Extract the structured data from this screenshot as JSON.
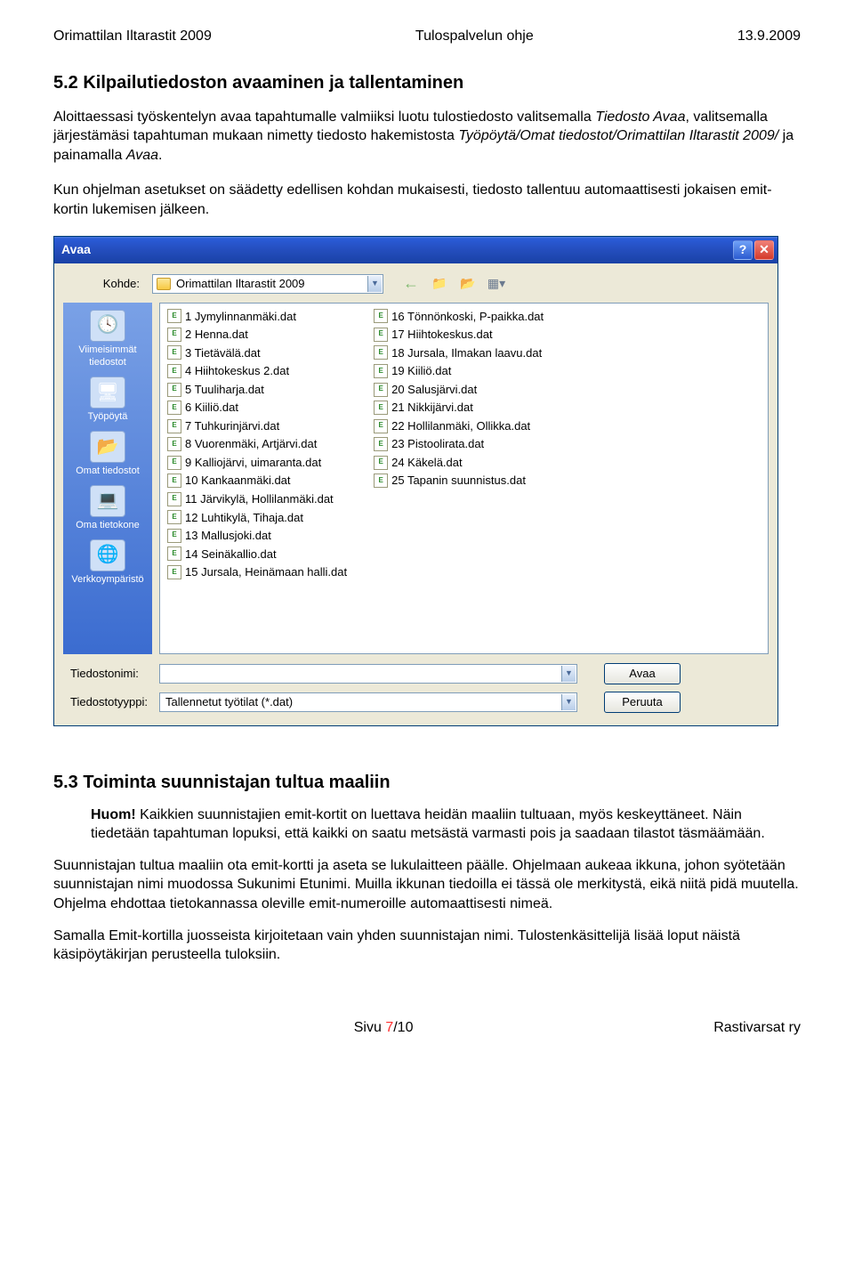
{
  "header": {
    "left": "Orimattilan Iltarastit 2009",
    "center": "Tulospalvelun ohje",
    "right": "13.9.2009"
  },
  "section52": {
    "title": "5.2 Kilpailutiedoston avaaminen ja tallentaminen",
    "p1a": "Aloittaessasi työskentelyn avaa tapahtumalle valmiiksi luotu tulostiedosto valitsemalla ",
    "p1b": "Tiedosto Avaa",
    "p1c": ", valitsemalla järjestämäsi tapahtuman mukaan nimetty tiedosto hakemistosta ",
    "p1d": "Työpöytä/Omat tiedostot/Orimattilan Iltarastit 2009/",
    "p1e": " ja painamalla ",
    "p1f": "Avaa",
    "p1g": ".",
    "p2": "Kun ohjelman asetukset on säädetty edellisen kohdan mukaisesti, tiedosto tallentuu automaattisesti jokaisen emit-kortin lukemisen jälkeen."
  },
  "dialog": {
    "title": "Avaa",
    "kohde_label": "Kohde:",
    "kohde_value": "Orimattilan Iltarastit 2009",
    "places": [
      {
        "icon": "🕓",
        "label": "Viimeisimmät tiedostot"
      },
      {
        "icon": "🖥",
        "label": "Työpöytä"
      },
      {
        "icon": "📂",
        "label": "Omat tiedostot"
      },
      {
        "icon": "💻",
        "label": "Oma tietokone"
      },
      {
        "icon": "🌐",
        "label": "Verkkoympäristö"
      }
    ],
    "files_col1": [
      "1 Jymylinnanmäki.dat",
      "2 Henna.dat",
      "3 Tietävälä.dat",
      "4 Hiihtokeskus 2.dat",
      "5 Tuuliharja.dat",
      "6 Kiiliö.dat",
      "7 Tuhkurinjärvi.dat",
      "8 Vuorenmäki, Artjärvi.dat",
      "9 Kalliojärvi, uimaranta.dat",
      "10 Kankaanmäki.dat",
      "11 Järvikylä, Hollilanmäki.dat",
      "12 Luhtikylä, Tihaja.dat",
      "13 Mallusjoki.dat",
      "14 Seinäkallio.dat",
      "15 Jursala, Heinämaan halli.dat"
    ],
    "files_col2": [
      "16 Tönnönkoski, P-paikka.dat",
      "17 Hiihtokeskus.dat",
      "18 Jursala, Ilmakan laavu.dat",
      "19 Kiiliö.dat",
      "20 Salusjärvi.dat",
      "21 Nikkijärvi.dat",
      "22 Hollilanmäki, Ollikka.dat",
      "23 Pistoolirata.dat",
      "24 Käkelä.dat",
      "25 Tapanin suunnistus.dat"
    ],
    "filename_label": "Tiedostonimi:",
    "filename_value": "",
    "filetype_label": "Tiedostotyyppi:",
    "filetype_value": "Tallennetut työtilat (*.dat)",
    "open_btn": "Avaa",
    "cancel_btn": "Peruuta"
  },
  "section53": {
    "title": "5.3 Toiminta suunnistajan tultua maaliin",
    "huom_label": "Huom!",
    "huom_text": " Kaikkien suunnistajien emit-kortit on luettava heidän maaliin tultuaan, myös keskeyttäneet. Näin tiedetään tapahtuman lopuksi, että kaikki on saatu metsästä varmasti pois ja saadaan tilastot täsmäämään.",
    "p1": "Suunnistajan tultua maaliin ota emit-kortti ja aseta se lukulaitteen päälle. Ohjelmaan aukeaa ikkuna, johon syötetään suunnistajan nimi muodossa Sukunimi Etunimi. Muilla ikkunan tiedoilla ei tässä ole merkitystä, eikä niitä pidä muutella. Ohjelma ehdottaa tietokannassa oleville emit-numeroille automaattisesti nimeä.",
    "p2": "Samalla Emit-kortilla juosseista kirjoitetaan vain yhden suunnistajan nimi. Tulostenkäsittelijä lisää loput näistä käsipöytäkirjan perusteella tuloksiin."
  },
  "footer": {
    "page_prefix": "Sivu ",
    "page_num": "7",
    "page_suffix": "/10",
    "right": "Rastivarsat ry"
  }
}
